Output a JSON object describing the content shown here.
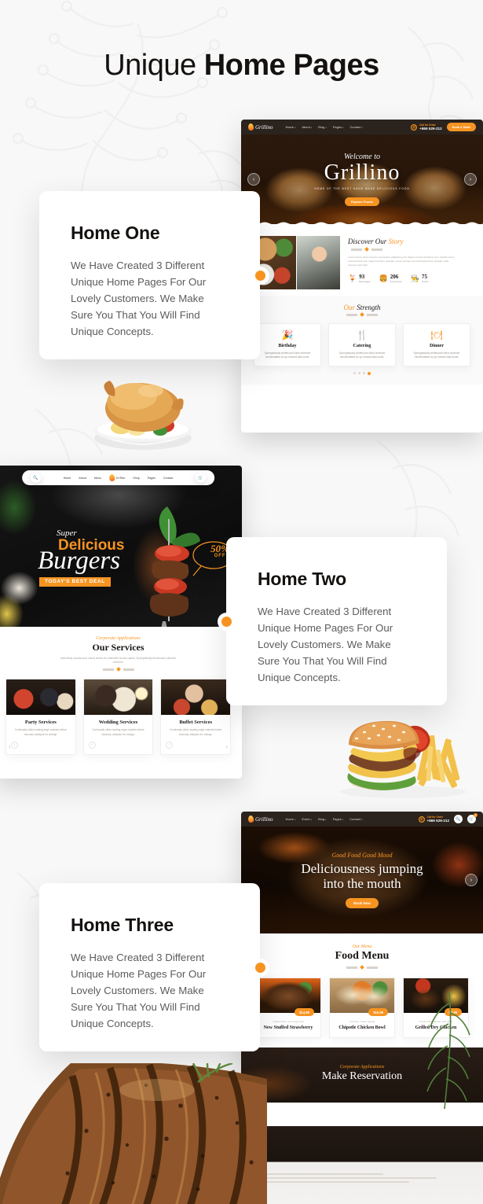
{
  "header": {
    "title_light": "Unique ",
    "title_bold": "Home Pages"
  },
  "shared": {
    "description": "We Have Created 3 Different Unique Home Pages For Our Lovely Customers. We Make Sure You That You Will Find Unique Concepts.",
    "brand": "Grillino",
    "nav": [
      "Home",
      "About",
      "Blog",
      "Pages",
      "Contact"
    ],
    "nav_two": [
      "Home",
      "About",
      "Menu",
      "Shop",
      "Pages",
      "Contact"
    ],
    "nav_three": [
      "Home",
      "Event",
      "Blog",
      "Pages",
      "Contact"
    ],
    "call_label": "Call for Order",
    "phone": "+869 529-212",
    "book_table": "Book a Table",
    "accent": "#f79421",
    "dark": "#19100a"
  },
  "cards": [
    {
      "title": "Home One",
      "text": "We Have Created 3 Different Unique Home Pages For Our Lovely Customers. We Make Sure You That You Will Find Unique Concepts."
    },
    {
      "title": "Home Two",
      "text": "We Have Created 3 Different Unique Home Pages For Our Lovely Customers. We Make Sure You That You Will Find Unique Concepts."
    },
    {
      "title": "Home Three",
      "text": "We Have Created 3 Different Unique Home Pages For Our Lovely Customers. We Make Sure You That You Will Find Unique Concepts."
    }
  ],
  "mockup_one": {
    "hero_welcome": "Welcome to",
    "hero_brand": "Grillino",
    "hero_sub": "HOME OF THE BEST HAND MADE DELICIOUS FOOD",
    "hero_cta": "Explore Foods",
    "story_title_plain": "Discover Our ",
    "story_title_script": "Story",
    "story_text": "Lorem ipsum dolor sit amet consectetur adipisicing elit. Magni corrupti doloribus cum. Debitis rerum reprehenderit cum magni nesciunt, aperiam, amet cumque commodi asperiores suscipit, nulla tempore quis fugit.",
    "stats": [
      {
        "value": "93",
        "label": "Beverages",
        "icon": "drink-icon"
      },
      {
        "value": "206",
        "label": "Food Items",
        "icon": "food-icon"
      },
      {
        "value": "75",
        "label": "Cooks",
        "icon": "chef-icon"
      }
    ],
    "strength_script": "Our ",
    "strength_title": "Strength",
    "strength_cards": [
      {
        "title": "Birthday",
        "text": "Synergistically whiteboard client-centered functionalities for go forward data world.",
        "icon": "confetti-icon"
      },
      {
        "title": "Catering",
        "text": "Synergistically whiteboard client-centered functionalities for go forward data world.",
        "icon": "cutlery-icon"
      },
      {
        "title": "Dinner",
        "text": "Synergistically whiteboard client-centered functionalities for go forward data world.",
        "icon": "cloche-icon"
      }
    ]
  },
  "mockup_two": {
    "hero_small": "Super",
    "hero_line1": "Delicious",
    "hero_line2": "Burgers",
    "hero_ribbon": "TODAY'S BEST DEAL",
    "badge_percent": "50%",
    "badge_off": "OFF",
    "services_label": "Corporate Applications",
    "services_title": "Our Services",
    "services_text": "Assertively crowdsource robust niches for extensible human capital. Synergistically benchmark customer networks.",
    "service_cards": [
      {
        "title": "Party Services",
        "text": "Continually utilize leading-edge markets before visionary catalysts for change."
      },
      {
        "title": "Wedding Services",
        "text": "Continually utilize leading-edge markets before visionary catalysts for change."
      },
      {
        "title": "Buffet Services",
        "text": "Continually utilize leading-edge markets before visionary catalysts for change."
      }
    ]
  },
  "mockup_three": {
    "hero_script": "Good Food Good Mood",
    "hero_line1": "Deliciousness jumping",
    "hero_line2": "into the mouth",
    "hero_cta": "Book Now",
    "menu_script": "Our Menu",
    "menu_title": "Food Menu",
    "menu_items": [
      {
        "sub": "Grilled Chop, Low Crispy Roll",
        "name": "New Stuffed Strawberry",
        "price": "$14.99"
      },
      {
        "sub": "Hot Fries, Yellow Jamba",
        "name": "Chipotle Chicken Bowl",
        "price": "$16.99"
      },
      {
        "sub": "Smoky Potat, Breast, Soft Jerky",
        "name": "Grilled Dry Chicken",
        "price": "$7.99"
      }
    ],
    "reservation_label": "Corporate Applications",
    "reservation_title": "Make Reservation",
    "cart_count": "2"
  }
}
